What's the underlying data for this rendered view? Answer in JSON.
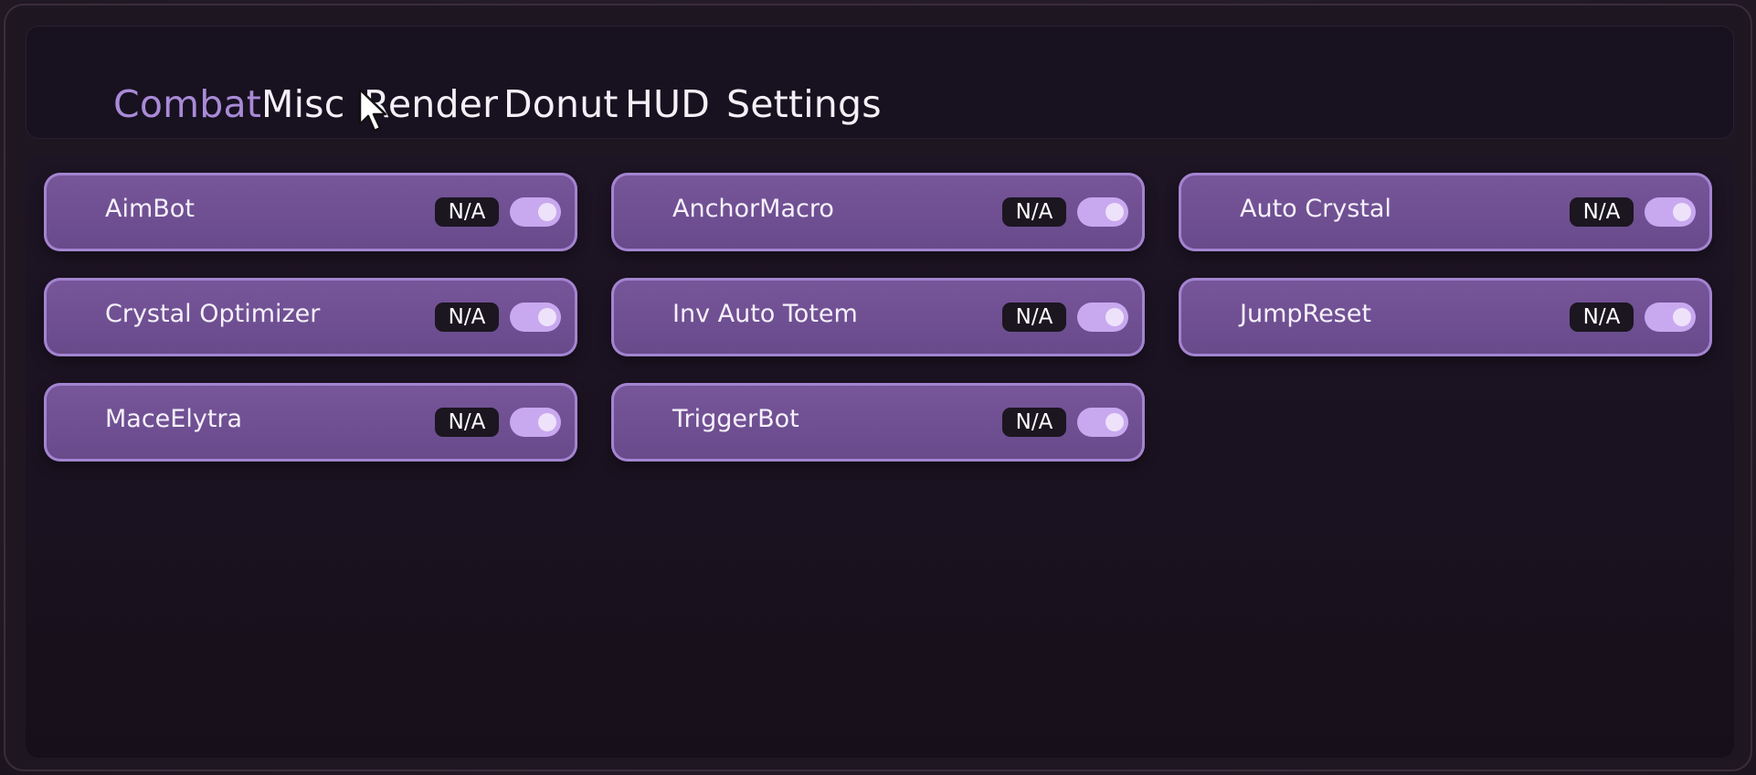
{
  "tabs": [
    {
      "label": "Combat",
      "active": true
    },
    {
      "label": "Misc",
      "active": false
    },
    {
      "label": "Render",
      "active": false
    },
    {
      "label": "Donut",
      "active": false
    },
    {
      "label": "HUD",
      "active": false
    },
    {
      "label": "Settings",
      "active": false
    }
  ],
  "modules": [
    {
      "label": "AimBot",
      "keybind": "N/A",
      "enabled": true
    },
    {
      "label": "AnchorMacro",
      "keybind": "N/A",
      "enabled": true
    },
    {
      "label": "Auto Crystal",
      "keybind": "N/A",
      "enabled": true
    },
    {
      "label": "Crystal Optimizer",
      "keybind": "N/A",
      "enabled": true
    },
    {
      "label": "Inv Auto Totem",
      "keybind": "N/A",
      "enabled": true
    },
    {
      "label": "JumpReset",
      "keybind": "N/A",
      "enabled": true
    },
    {
      "label": "MaceElytra",
      "keybind": "N/A",
      "enabled": true
    },
    {
      "label": "TriggerBot",
      "keybind": "N/A",
      "enabled": true
    }
  ],
  "colors": {
    "accent": "#a98ad7",
    "module_bg": "#6f5093",
    "module_border": "#a384d0",
    "toggle_on": "#c8a8ef"
  },
  "icons": {
    "cursor": "mouse-pointer-icon"
  }
}
